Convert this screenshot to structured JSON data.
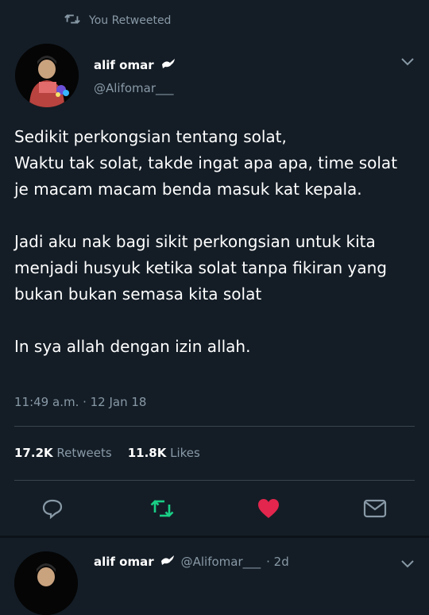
{
  "retweet_banner": {
    "text": "You Retweeted"
  },
  "tweet": {
    "author_name": "alif omar",
    "author_handle": "@Alifomar___",
    "paragraphs": [
      "Sedikit perkongsian tentang solat,\nWaktu tak solat, takde ingat apa apa, time solat je macam macam benda masuk kat kepala.",
      "Jadi aku nak bagi sikit perkongsian untuk kita menjadi husyuk ketika solat tanpa fikiran yang bukan bukan semasa kita solat",
      "In sya allah dengan izin allah."
    ],
    "timestamp": "11:49 a.m. · 12 Jan 18",
    "retweets_count": "17.2K",
    "retweets_label": "Retweets",
    "likes_count": "11.8K",
    "likes_label": "Likes"
  },
  "actions": {
    "icons": [
      "reply-icon",
      "retweet-icon",
      "like-icon",
      "message-icon"
    ]
  },
  "next_tweet": {
    "author_name": "alif omar",
    "author_handle": "@Alifomar___",
    "time": "· 2d"
  },
  "colors": {
    "background": "#141d26",
    "secondary_text": "#8899a6",
    "retweet_active": "#19cf86",
    "like_active": "#e2264d",
    "divider": "#38444d"
  }
}
